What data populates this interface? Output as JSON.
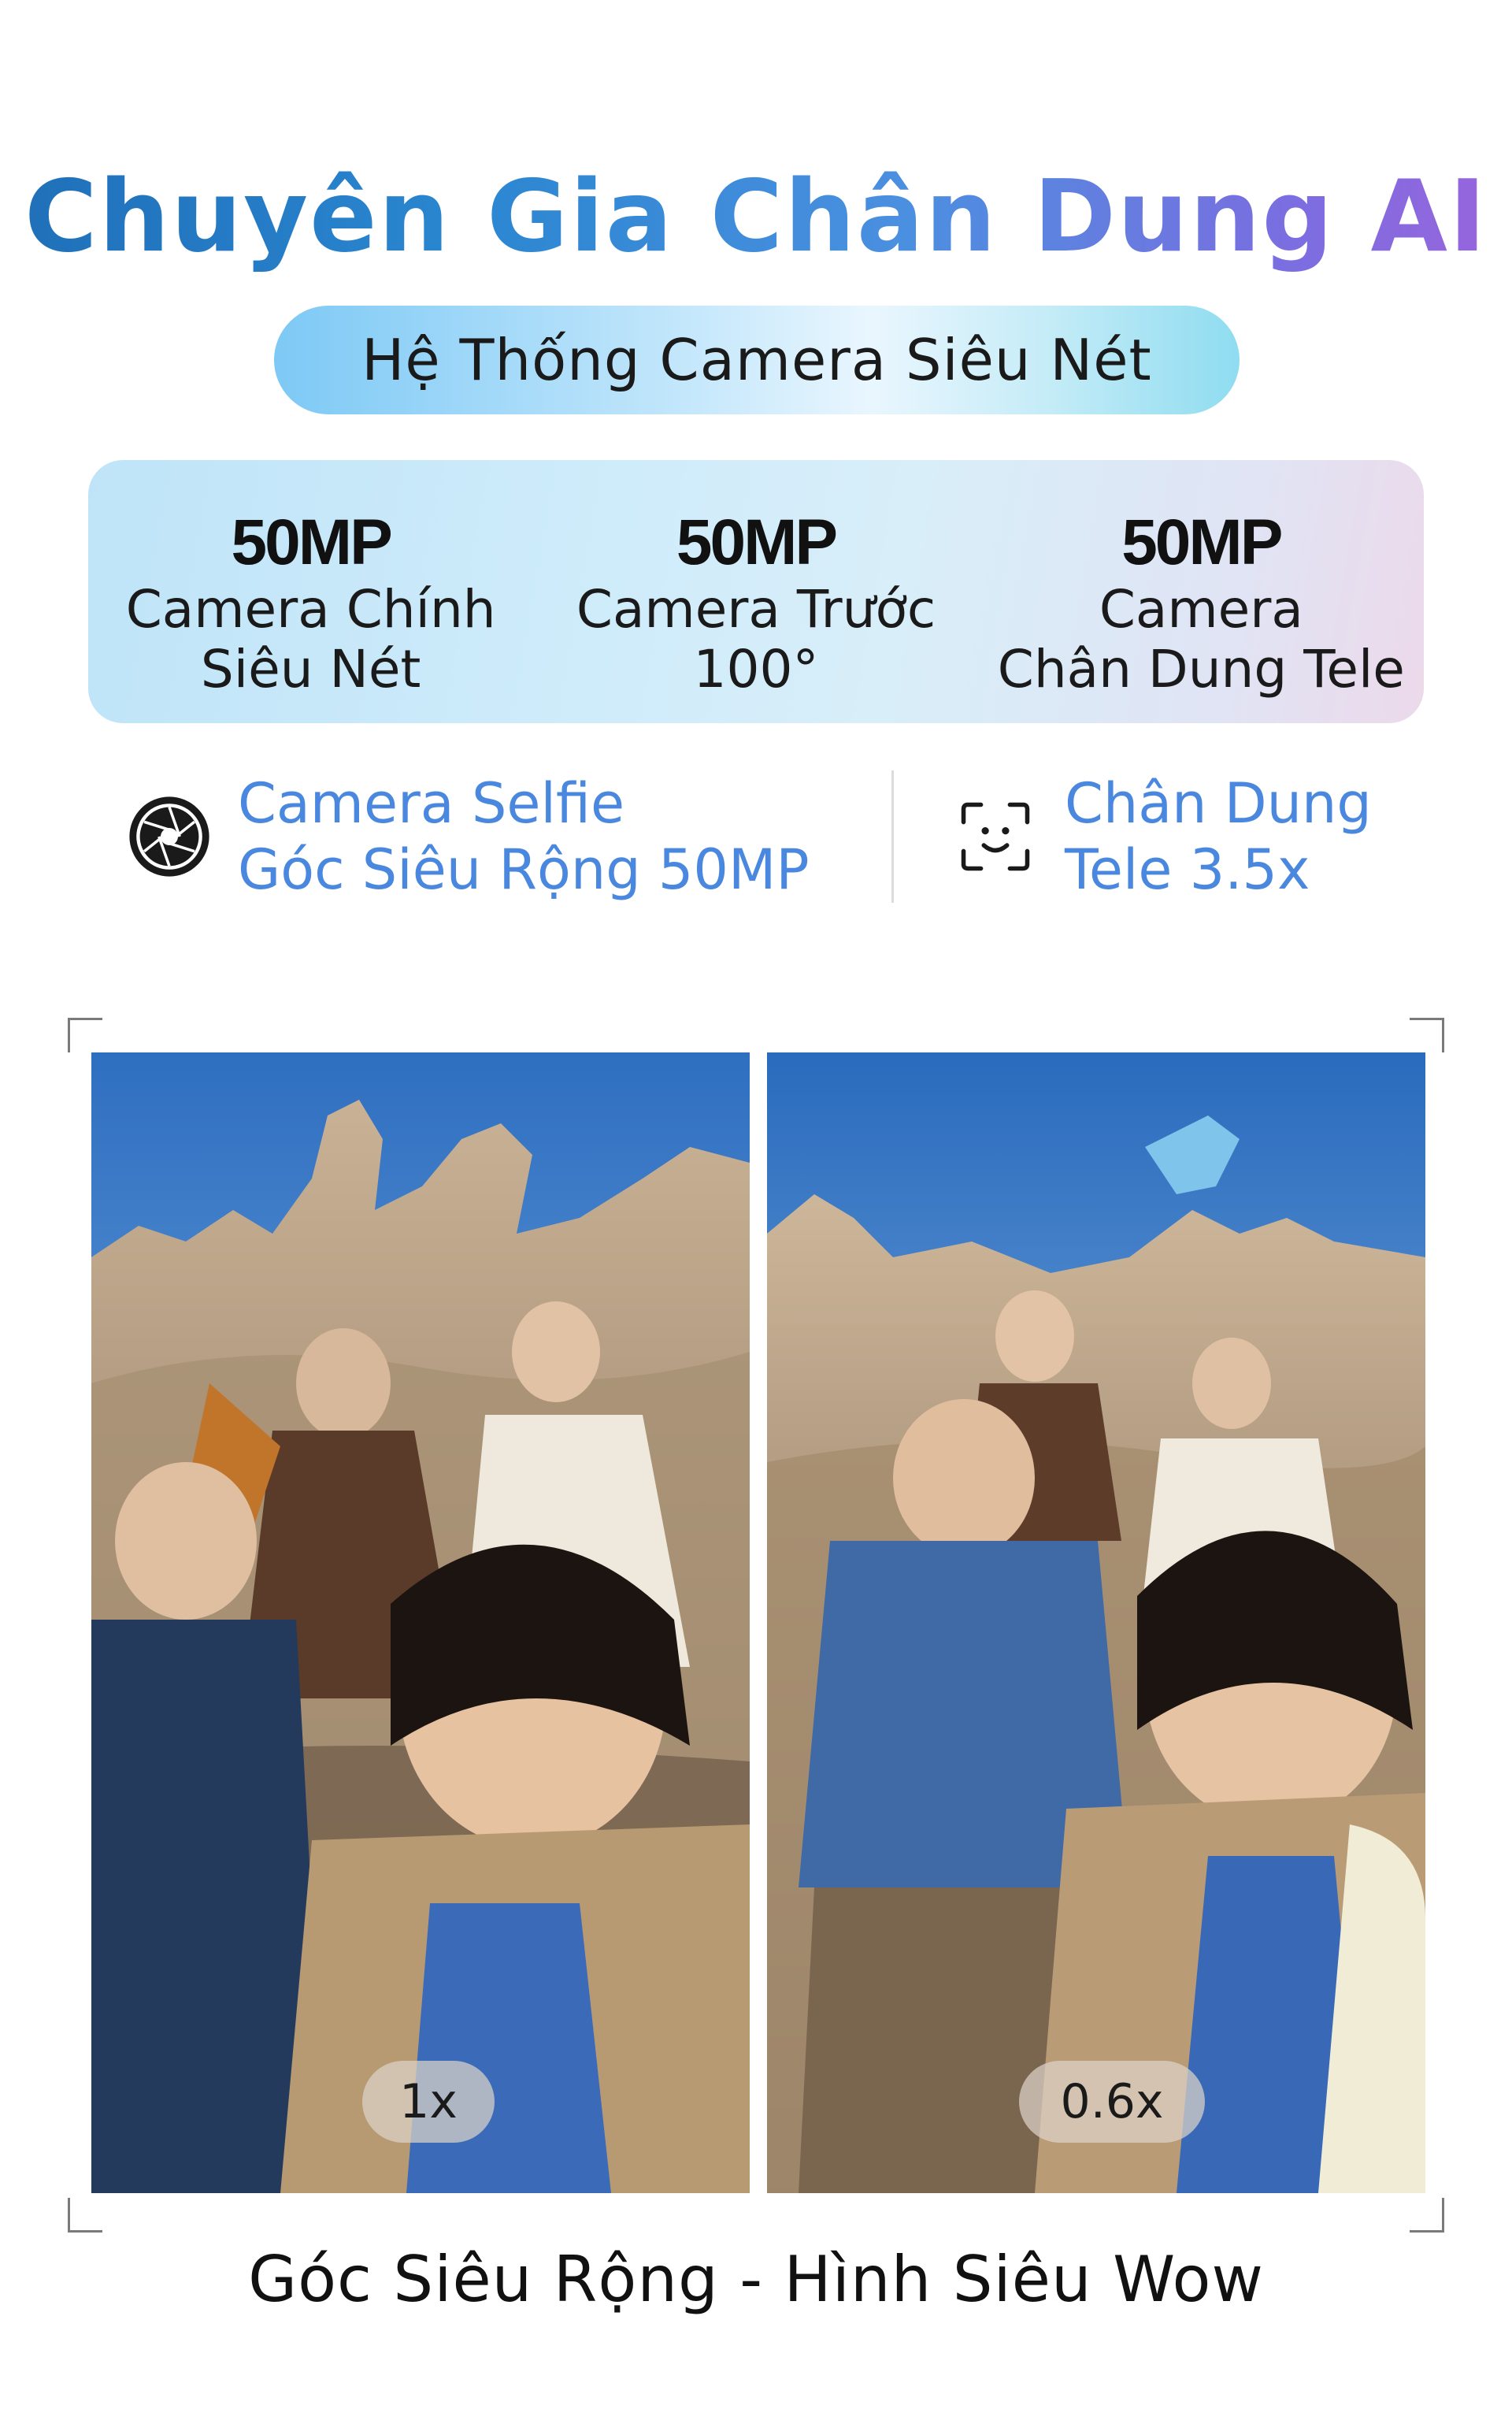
{
  "headline": "Chuyên Gia Chân Dung AI",
  "subtitle_pill": "Hệ Thống Camera Siêu Nét",
  "specs": [
    {
      "value": "50MP",
      "line1": "Camera Chính",
      "line2": "Siêu Nét"
    },
    {
      "value": "50MP",
      "line1": "Camera Trước",
      "line2": "100°"
    },
    {
      "value": "50MP",
      "line1": "Camera",
      "line2": "Chân Dung Tele"
    }
  ],
  "features": [
    {
      "icon": "camera-aperture-icon",
      "line1": "Camera Selfie",
      "line2": "Góc Siêu Rộng 50MP"
    },
    {
      "icon": "face-focus-icon",
      "line1": "Chân Dung",
      "line2": "Tele 3.5x"
    }
  ],
  "photos": [
    {
      "zoom_label": "1x"
    },
    {
      "zoom_label": "0.6x"
    }
  ],
  "caption": "Góc Siêu Rộng - Hình Siêu Wow",
  "colors": {
    "headline_gradient": [
      "#1f6fb8",
      "#4b8fe0",
      "#9a64dc"
    ],
    "feature_text": "#4a88df",
    "pill_gradient": [
      "#7dc9f5",
      "#e9f6fe",
      "#8fdcf0"
    ]
  }
}
